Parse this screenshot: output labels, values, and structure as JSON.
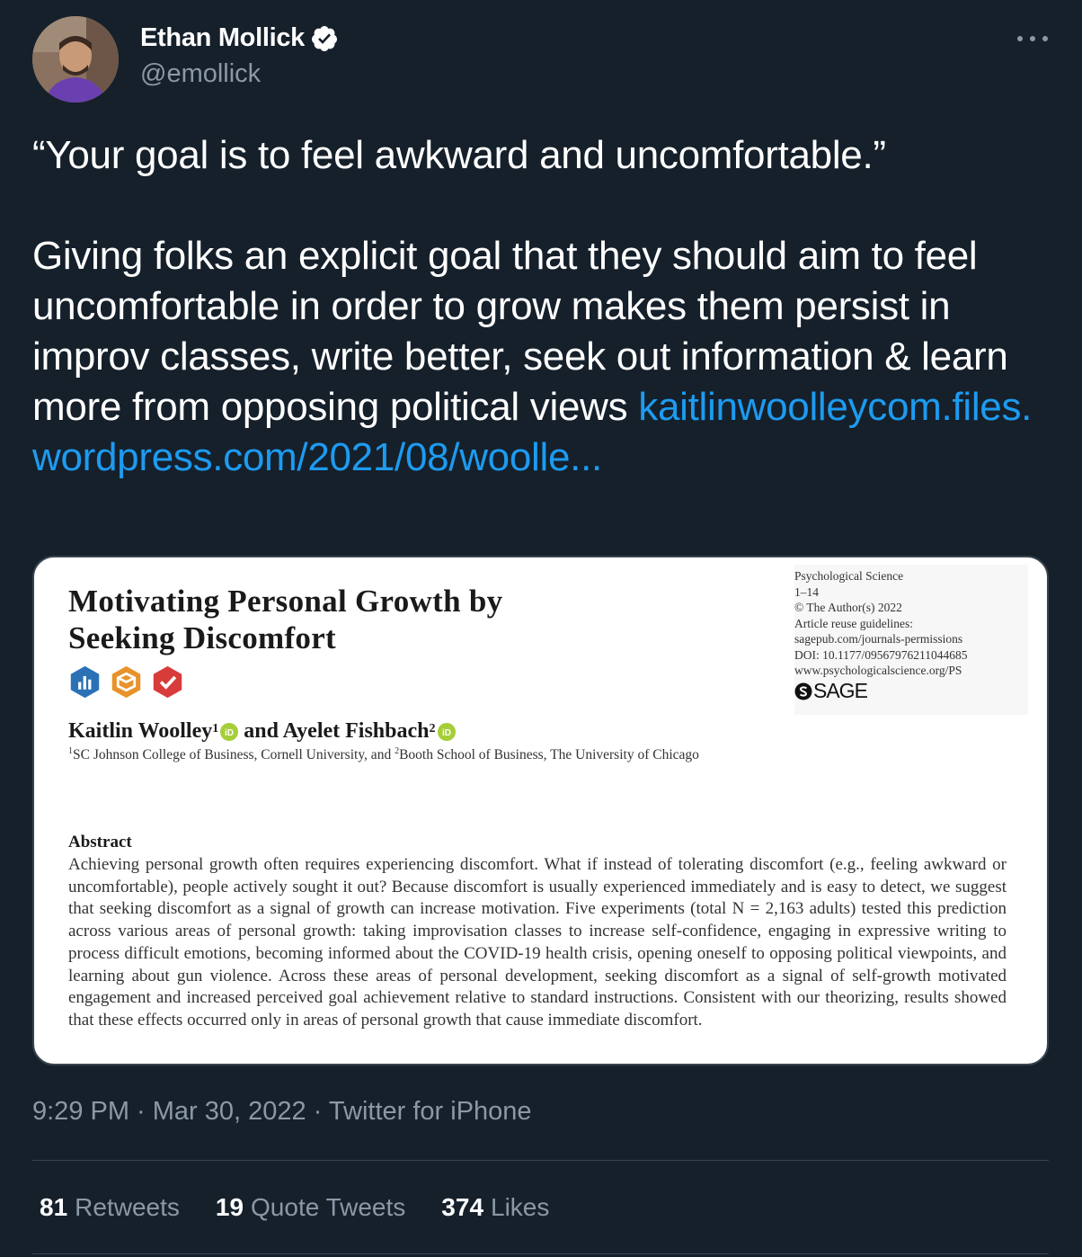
{
  "author": {
    "name": "Ethan Mollick",
    "handle": "@emollick"
  },
  "tweet": {
    "quote_line": "“Your goal is to feel awkward and uncomfortable.”",
    "body": "Giving folks an explicit goal that they should aim to feel uncomfortable in order to grow makes them persist in improv classes, write better, seek out information & learn more from opposing political views",
    "link": "kaitlinwoolleycom.files.wordpress.com/2021/08/woolle..."
  },
  "card": {
    "title_line1": "Motivating Personal Growth by",
    "title_line2": "Seeking Discomfort",
    "meta": {
      "journal": "Psychological Science",
      "pages": "1–14",
      "copyright": "© The Author(s) 2022",
      "reuse_label": "Article reuse guidelines:",
      "reuse_url": "sagepub.com/journals-permissions",
      "doi": "DOI: 10.1177/09567976211044685",
      "site": "www.psychologicalscience.org/PS",
      "publisher": "SAGE"
    },
    "authors": {
      "author1": "Kaitlin Woolley",
      "author1_sup": "1",
      "and": "and Ayelet Fishbach",
      "author2_sup": "2"
    },
    "affiliation": {
      "sup1": "1",
      "part1": "SC Johnson College of Business, Cornell University, and ",
      "sup2": "2",
      "part2": "Booth School of Business, The University of Chicago"
    },
    "abstract_heading": "Abstract",
    "abstract_text": "Achieving personal growth often requires experiencing discomfort. What if instead of tolerating discomfort (e.g., feeling awkward or uncomfortable), people actively sought it out? Because discomfort is usually experienced immediately and is easy to detect, we suggest that seeking discomfort as a signal of growth can increase motivation. Five experiments (total N = 2,163 adults) tested this prediction across various areas of personal growth: taking improvisation classes to increase self-confidence, engaging in expressive writing to process difficult emotions, becoming informed about the COVID-19 health crisis, opening oneself to opposing political viewpoints, and learning about gun violence. Across these areas of personal development, seeking discomfort as a signal of self-growth motivated engagement and increased perceived goal achievement relative to standard instructions. Consistent with our theorizing, results showed that these effects occurred only in areas of personal growth that cause immediate discomfort."
  },
  "timestamp": "9:29 PM · Mar 30, 2022 · Twitter for iPhone",
  "stats": {
    "retweets_count": "81",
    "retweets_label": "Retweets",
    "quotes_count": "19",
    "quotes_label": "Quote Tweets",
    "likes_count": "374",
    "likes_label": "Likes"
  },
  "icons": {
    "verified": "verified-badge-icon",
    "more": "more-icon",
    "badge_data": "open-data-badge-icon",
    "badge_materials": "open-materials-badge-icon",
    "badge_prereg": "preregistered-badge-icon",
    "orcid": "orcid-icon"
  },
  "colors": {
    "background": "#15202b",
    "link": "#1d9bf0",
    "muted": "#8b98a5",
    "verified": "#ffffff"
  }
}
